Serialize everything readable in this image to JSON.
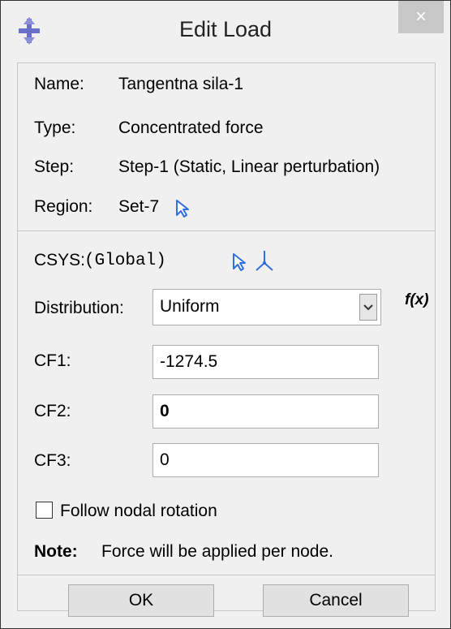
{
  "window": {
    "title": "Edit Load",
    "close_glyph": "×",
    "app_icon": "load-crosshair-icon"
  },
  "info": {
    "name_label": "Name:",
    "name_value": "Tangentna sila-1",
    "type_label": "Type:",
    "type_value": "Concentrated force",
    "step_label": "Step:",
    "step_value": "Step-1 (Static, Linear perturbation)",
    "region_label": "Region:",
    "region_value": "Set-7",
    "region_icon": "select-arrow-icon"
  },
  "csys": {
    "label": "CSYS:",
    "value": "(Global)",
    "select_icon": "select-arrow-icon",
    "axes_icon": "csys-axes-icon"
  },
  "distribution": {
    "label": "Distribution:",
    "value": "Uniform",
    "fx_label": "f(x)"
  },
  "fields": [
    {
      "label": "CF1:",
      "value": "-1274.5"
    },
    {
      "label": "CF2:",
      "value": "0"
    },
    {
      "label": "CF3:",
      "value": "0"
    }
  ],
  "follow_rotation": {
    "label": "Follow nodal rotation",
    "checked": false
  },
  "note": {
    "label": "Note:",
    "text": "Force will be applied per node."
  },
  "buttons": {
    "ok": "OK",
    "cancel": "Cancel"
  },
  "colors": {
    "accent_icon": "#2f6fe0",
    "window_bg": "#f0f0f0",
    "close_button_bg": "#c7c7c7"
  }
}
